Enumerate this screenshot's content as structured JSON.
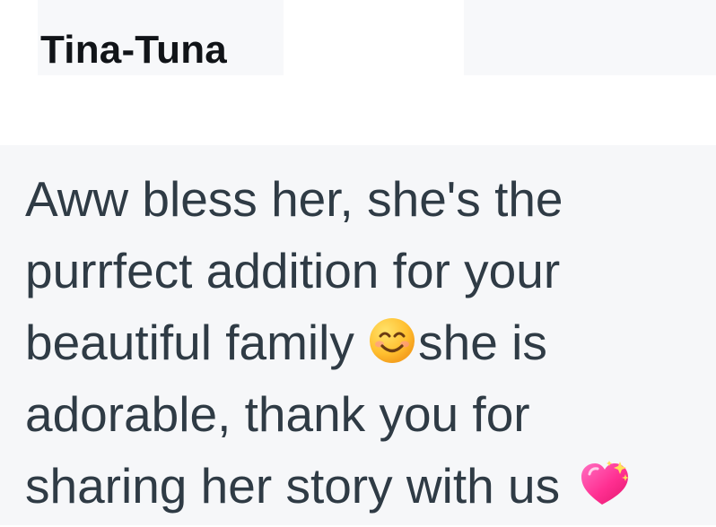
{
  "comment": {
    "author": "Tina-Tuna",
    "text_part1": "Aww bless her, she's the purrfect addition for your beautiful family ",
    "text_part2": "she is adorable, thank you for sharing her story with us ",
    "emoji_1": "smiling-face-with-smiling-eyes-icon",
    "emoji_2": "sparkling-heart-icon"
  },
  "colors": {
    "author_text": "#111418",
    "comment_text": "#2f3b45",
    "bubble_background": "#f6f7f9",
    "page_background": "#ffffff"
  }
}
